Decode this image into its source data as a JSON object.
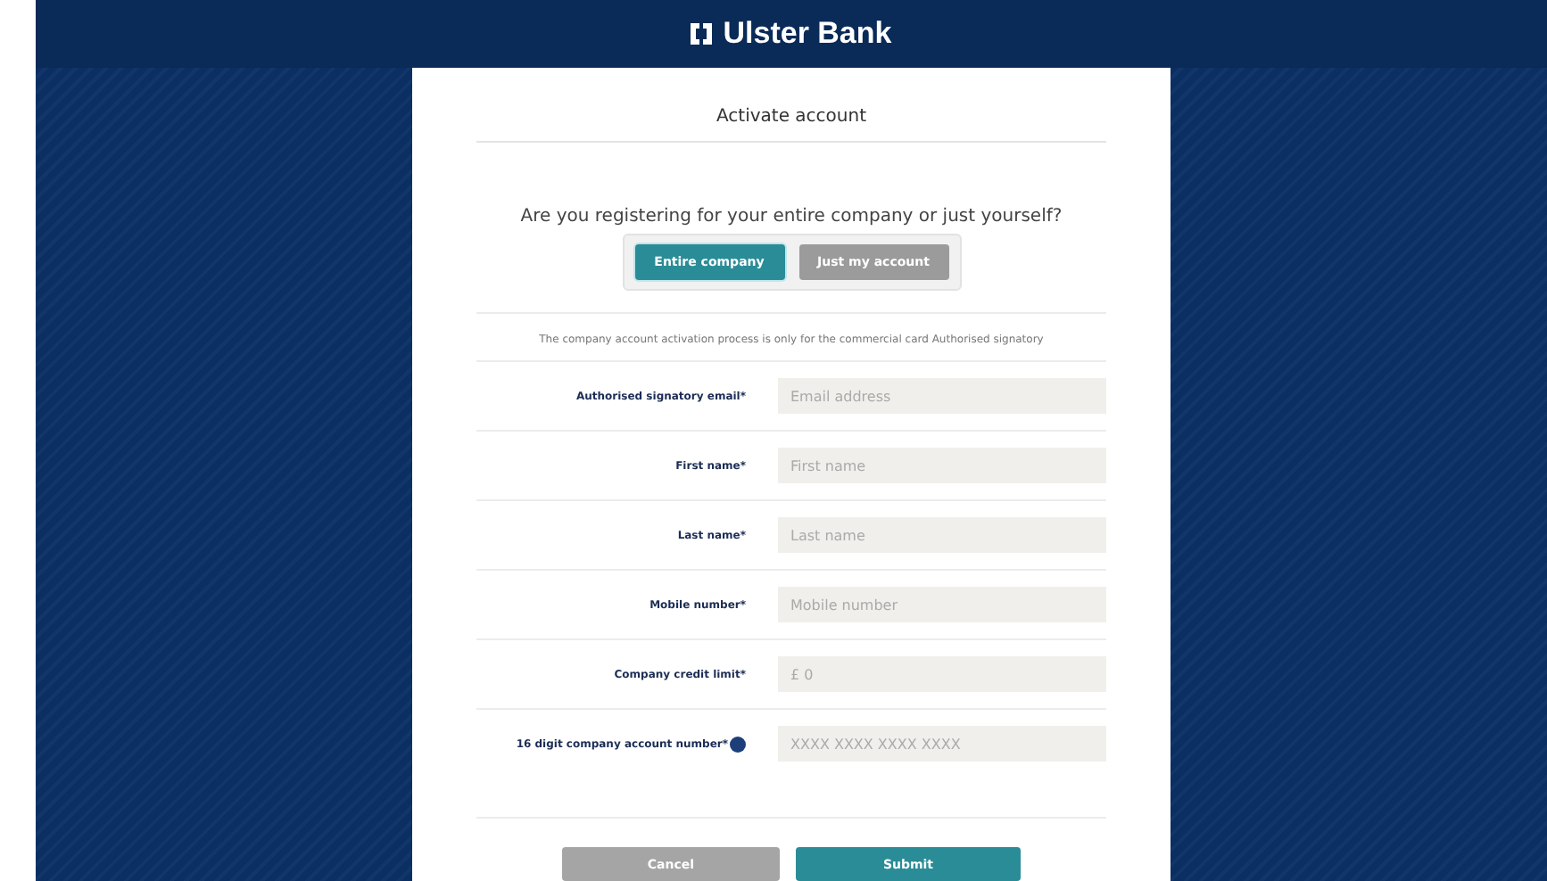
{
  "header": {
    "brand": "Ulster Bank"
  },
  "form": {
    "title": "Activate account",
    "question": "Are you registering for your entire company or just yourself?",
    "options": [
      {
        "label": "Entire company",
        "selected": true
      },
      {
        "label": "Just my account",
        "selected": false
      }
    ],
    "notice": "The company account activation process is only for the commercial card Authorised signatory",
    "fields": [
      {
        "label": "Authorised signatory email*",
        "placeholder": "Email address",
        "help": false
      },
      {
        "label": "First name*",
        "placeholder": "First name",
        "help": false
      },
      {
        "label": "Last name*",
        "placeholder": "Last name",
        "help": false
      },
      {
        "label": "Mobile number*",
        "placeholder": "Mobile number",
        "help": false
      },
      {
        "label": "Company credit limit*",
        "placeholder": "£ 0",
        "help": false
      },
      {
        "label": "16 digit company account number*",
        "placeholder": "XXXX XXXX XXXX XXXX",
        "help": true
      }
    ],
    "buttons": [
      {
        "label": "Cancel",
        "kind": "secondary"
      },
      {
        "label": "Submit",
        "kind": "primary"
      }
    ]
  }
}
